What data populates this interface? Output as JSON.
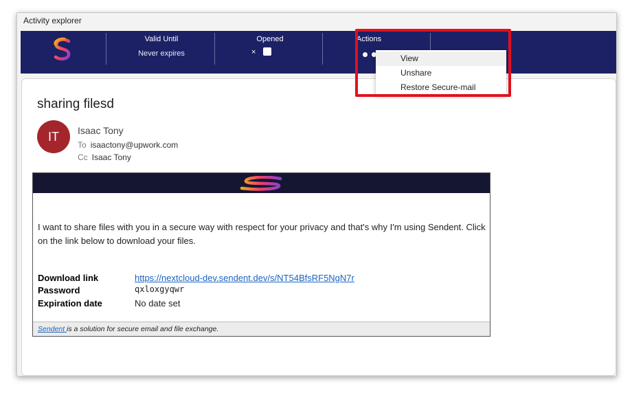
{
  "window": {
    "title": "Activity explorer"
  },
  "header": {
    "valid_until_label": "Valid Until",
    "valid_until_value": "Never expires",
    "opened_label": "Opened",
    "opened_x": "×",
    "actions_label": "Actions"
  },
  "actions_menu": {
    "items": [
      {
        "label": "View"
      },
      {
        "label": "Unshare"
      },
      {
        "label": "Restore Secure-mail"
      }
    ]
  },
  "email": {
    "subject": "sharing filesd",
    "avatar_initials": "IT",
    "sender_name": "Isaac Tony",
    "to_prefix": "To",
    "to_value": "isaactony@upwork.com",
    "cc_prefix": "Cc",
    "cc_value": "Isaac Tony"
  },
  "card": {
    "message": "I want to share files with you in a secure way with respect for your privacy and that's why I'm using Sendent. Click on the link below to download your files.",
    "download_label": "Download link",
    "download_url": "https://nextcloud-dev.sendent.dev/s/NT54BfsRF5NgN7r",
    "password_label": "Password",
    "password_value": "qxloxgyqwr",
    "expiration_label": "Expiration date",
    "expiration_value": "No date set",
    "footer_link": "Sendent ",
    "footer_text": "is a solution for secure email and file exchange."
  },
  "colors": {
    "header_bg": "#1c2166",
    "card_band": "#141632",
    "avatar": "#a4262c",
    "highlight": "#e3101d",
    "link": "#1a63c2"
  },
  "icons": {
    "brand": "sendent-logo-icon",
    "opened_checkbox": "checkbox-icon",
    "actions_more": "more-dots-icon"
  }
}
